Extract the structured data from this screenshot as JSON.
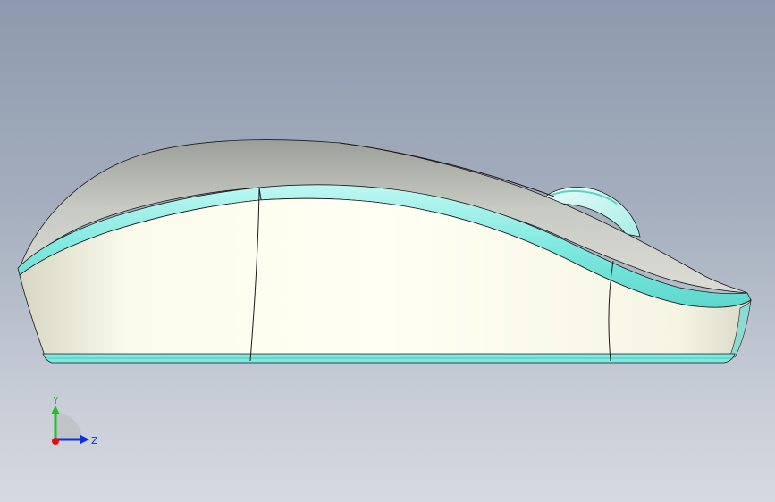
{
  "viewport": {
    "background_top": "#8e9aad",
    "background_bottom": "#d6dae0"
  },
  "model": {
    "shell_color": "#c9cbc6",
    "side_color": "#f5f4e6",
    "accent_color": "#7fe9e0",
    "edge_color": "#1a1a1a"
  },
  "triad": {
    "y_label": "Y",
    "z_label": "Z",
    "y_color": "#20c020",
    "z_color": "#1030e0",
    "x_color": "#e01010"
  }
}
